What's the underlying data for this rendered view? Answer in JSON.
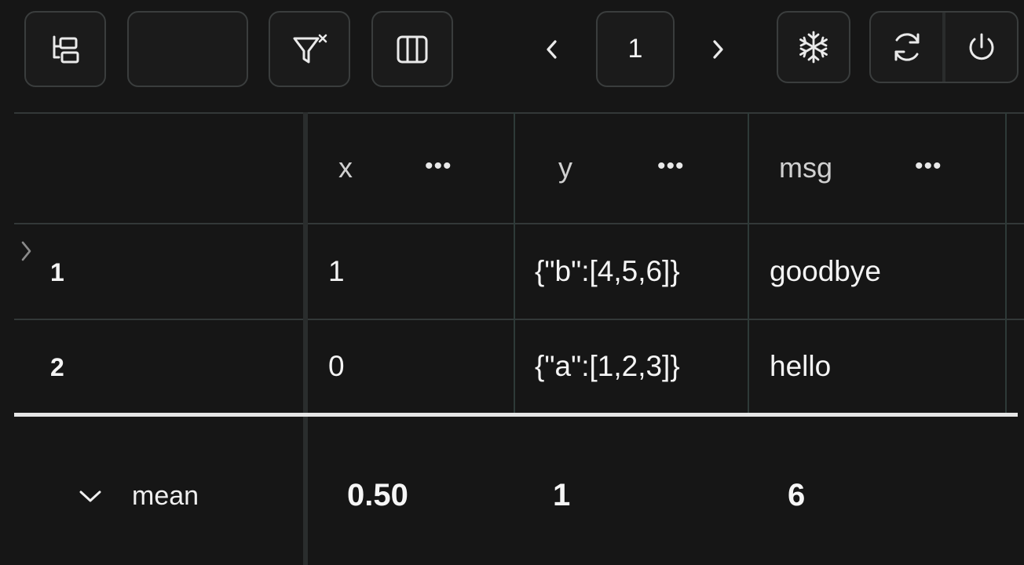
{
  "toolbar": {
    "tree_icon": "tree-view-icon",
    "search_value": "",
    "filter_clear_icon": "filter-clear-icon",
    "columns_icon": "columns-icon",
    "prev_icon": "chevron-left-icon",
    "page": "1",
    "next_icon": "chevron-right-icon",
    "freeze_icon": "snowflake-icon",
    "refresh_icon": "refresh-icon",
    "power_icon": "power-icon"
  },
  "table": {
    "columns": [
      {
        "name": "x",
        "menu": "•••"
      },
      {
        "name": "y",
        "menu": "•••"
      },
      {
        "name": "msg",
        "menu": "•••"
      }
    ],
    "rows": [
      {
        "index": "1",
        "x": "1",
        "y": "{\"b\":[4,5,6]}",
        "msg": "goodbye"
      },
      {
        "index": "2",
        "x": "0",
        "y": "{\"a\":[1,2,3]}",
        "msg": "hello"
      }
    ],
    "aggregate": {
      "label": "mean",
      "x": "0.50",
      "y": "1",
      "msg": "6"
    }
  },
  "colors": {
    "background": "#161616",
    "border": "#3a3d3d",
    "gridline": "#333838"
  }
}
